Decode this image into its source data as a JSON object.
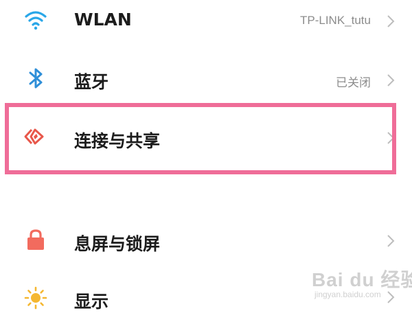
{
  "settings": {
    "items": [
      {
        "title": "WLAN",
        "status": "TP-LINK_tutu",
        "icon": "wifi-icon"
      },
      {
        "title": "蓝牙",
        "status": "已关闭",
        "icon": "bluetooth-icon"
      },
      {
        "title": "连接与共享",
        "status": "",
        "icon": "connection-sharing-icon"
      },
      {
        "title": "息屏与锁屏",
        "status": "",
        "icon": "lock-icon"
      },
      {
        "title": "显示",
        "status": "",
        "icon": "sun-icon"
      }
    ]
  },
  "colors": {
    "wifi": "#2aa7e8",
    "bluetooth": "#2f8fd8",
    "connection": "#e8574a",
    "lock": "#f26b5e",
    "sun": "#f5b731",
    "highlight": "#ef6d98",
    "chevron": "#bdbdbd"
  },
  "watermark": {
    "main": "Bai du 经验",
    "sub": "jingyan.baidu.com"
  }
}
